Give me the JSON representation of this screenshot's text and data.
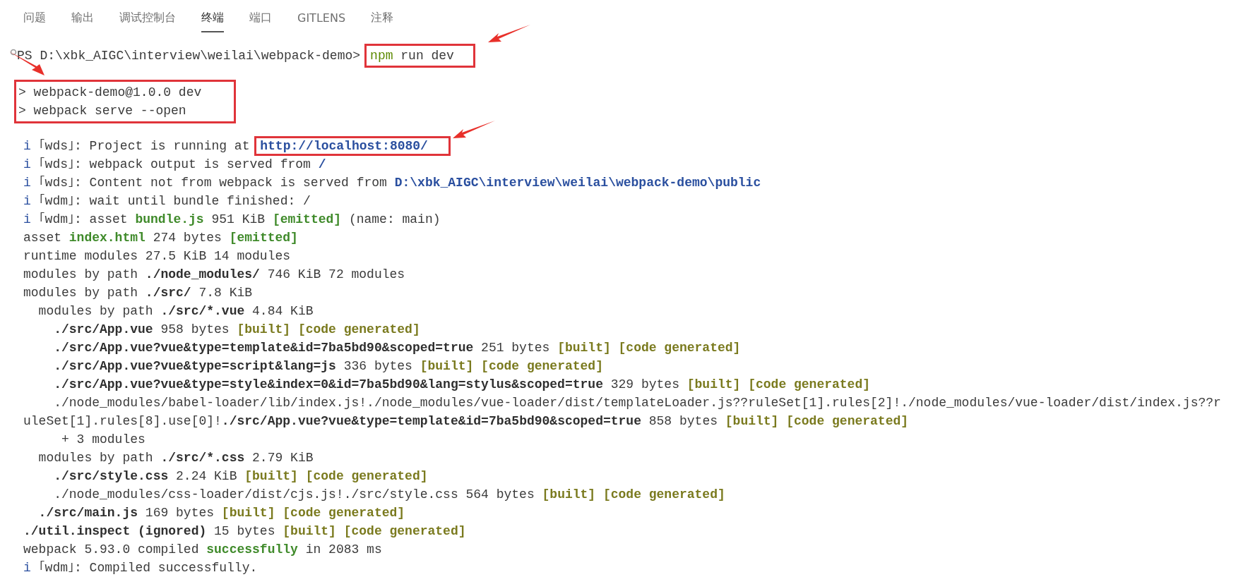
{
  "tabs": [
    {
      "label": "问题",
      "selected": false
    },
    {
      "label": "输出",
      "selected": false
    },
    {
      "label": "调试控制台",
      "selected": false
    },
    {
      "label": "终端",
      "selected": true
    },
    {
      "label": "端口",
      "selected": false
    },
    {
      "label": "GITLENS",
      "selected": false
    },
    {
      "label": "注释",
      "selected": false
    }
  ],
  "prompt": {
    "path": "PS D:\\xbk_AIGC\\interview\\weilai\\webpack-demo>",
    "command": [
      {
        "text": "npm",
        "kind": "command"
      },
      {
        "text": " run dev",
        "kind": "plain"
      }
    ],
    "boxed": true
  },
  "script_echo": {
    "boxed": true,
    "lines": [
      "> webpack-demo@1.0.0 dev",
      "> webpack serve --open"
    ]
  },
  "log_lines": [
    {
      "segments": [
        {
          "text": "i",
          "kind": "info"
        },
        {
          "text": " ｢wds｣: Project is running at ",
          "kind": "plain"
        },
        {
          "text": "http://localhost:8080/",
          "kind": "link",
          "boxed": true
        }
      ]
    },
    {
      "segments": [
        {
          "text": "i",
          "kind": "info"
        },
        {
          "text": " ｢wds｣: webpack output is served from ",
          "kind": "plain"
        },
        {
          "text": "/",
          "kind": "path"
        }
      ]
    },
    {
      "segments": [
        {
          "text": "i",
          "kind": "info"
        },
        {
          "text": " ｢wds｣: Content not from webpack is served from ",
          "kind": "plain"
        },
        {
          "text": "D:\\xbk_AIGC\\interview\\weilai\\webpack-demo\\public",
          "kind": "path"
        }
      ]
    },
    {
      "segments": [
        {
          "text": "i",
          "kind": "info"
        },
        {
          "text": " ｢wdm｣: wait until bundle finished: /",
          "kind": "plain"
        }
      ]
    },
    {
      "segments": [
        {
          "text": "i",
          "kind": "info"
        },
        {
          "text": " ｢wdm｣: asset ",
          "kind": "plain"
        },
        {
          "text": "bundle.js",
          "kind": "success"
        },
        {
          "text": " 951 KiB ",
          "kind": "plain"
        },
        {
          "text": "[emitted]",
          "kind": "success"
        },
        {
          "text": " (name: main)",
          "kind": "plain"
        }
      ]
    },
    {
      "segments": [
        {
          "text": "asset ",
          "kind": "plain"
        },
        {
          "text": "index.html",
          "kind": "success"
        },
        {
          "text": " 274 bytes ",
          "kind": "plain"
        },
        {
          "text": "[emitted]",
          "kind": "success"
        }
      ]
    },
    {
      "segments": [
        {
          "text": "runtime modules 27.5 KiB 14 modules",
          "kind": "plain"
        }
      ]
    },
    {
      "segments": [
        {
          "text": "modules by path ",
          "kind": "plain"
        },
        {
          "text": "./node_modules/",
          "kind": "bold"
        },
        {
          "text": " 746 KiB 72 modules",
          "kind": "plain"
        }
      ]
    },
    {
      "segments": [
        {
          "text": "modules by path ",
          "kind": "plain"
        },
        {
          "text": "./src/",
          "kind": "bold"
        },
        {
          "text": " 7.8 KiB",
          "kind": "plain"
        }
      ]
    },
    {
      "segments": [
        {
          "text": "  modules by path ",
          "kind": "plain"
        },
        {
          "text": "./src/*.vue",
          "kind": "bold"
        },
        {
          "text": " 4.84 KiB",
          "kind": "plain"
        }
      ]
    },
    {
      "segments": [
        {
          "text": "    ./src/App.vue",
          "kind": "bold"
        },
        {
          "text": " 958 bytes ",
          "kind": "plain"
        },
        {
          "text": "[built] [code generated]",
          "kind": "note"
        }
      ]
    },
    {
      "segments": [
        {
          "text": "    ./src/App.vue?vue&type=template&id=7ba5bd90&scoped=true",
          "kind": "bold"
        },
        {
          "text": " 251 bytes ",
          "kind": "plain"
        },
        {
          "text": "[built] [code generated]",
          "kind": "note"
        }
      ]
    },
    {
      "segments": [
        {
          "text": "    ./src/App.vue?vue&type=script&lang=js",
          "kind": "bold"
        },
        {
          "text": " 336 bytes ",
          "kind": "plain"
        },
        {
          "text": "[built] [code generated]",
          "kind": "note"
        }
      ]
    },
    {
      "segments": [
        {
          "text": "    ./src/App.vue?vue&type=style&index=0&id=7ba5bd90&lang=stylus&scoped=true",
          "kind": "bold"
        },
        {
          "text": " 329 bytes ",
          "kind": "plain"
        },
        {
          "text": "[built] [code generated]",
          "kind": "note"
        }
      ]
    },
    {
      "segments": [
        {
          "text": "    ./node_modules/babel-loader/lib/index.js!./node_modules/vue-loader/dist/templateLoader.js??ruleSet[1].rules[2]!./node_modules/vue-loader/dist/index.js??r",
          "kind": "plain"
        }
      ]
    },
    {
      "segments": [
        {
          "text": "uleSet[1].rules[8].use[0]!",
          "kind": "plain"
        },
        {
          "text": "./src/App.vue?vue&type=template&id=7ba5bd90&scoped=true",
          "kind": "bold"
        },
        {
          "text": " 858 bytes ",
          "kind": "plain"
        },
        {
          "text": "[built] [code generated]",
          "kind": "note"
        }
      ]
    },
    {
      "segments": [
        {
          "text": "     + 3 modules",
          "kind": "plain"
        }
      ]
    },
    {
      "segments": [
        {
          "text": "  modules by path ",
          "kind": "plain"
        },
        {
          "text": "./src/*.css",
          "kind": "bold"
        },
        {
          "text": " 2.79 KiB",
          "kind": "plain"
        }
      ]
    },
    {
      "segments": [
        {
          "text": "    ./src/style.css",
          "kind": "bold"
        },
        {
          "text": " 2.24 KiB ",
          "kind": "plain"
        },
        {
          "text": "[built] [code generated]",
          "kind": "note"
        }
      ]
    },
    {
      "segments": [
        {
          "text": "    ./node_modules/css-loader/dist/cjs.js!./src/style.css 564 bytes ",
          "kind": "plain"
        },
        {
          "text": "[built] [code generated]",
          "kind": "note"
        }
      ]
    },
    {
      "segments": [
        {
          "text": "  ./src/main.js",
          "kind": "bold"
        },
        {
          "text": " 169 bytes ",
          "kind": "plain"
        },
        {
          "text": "[built] [code generated]",
          "kind": "note"
        }
      ]
    },
    {
      "segments": [
        {
          "text": "./util.inspect (ignored)",
          "kind": "bold"
        },
        {
          "text": " 15 bytes ",
          "kind": "plain"
        },
        {
          "text": "[built] [code generated]",
          "kind": "note"
        }
      ]
    },
    {
      "segments": [
        {
          "text": "webpack 5.93.0 compiled ",
          "kind": "plain"
        },
        {
          "text": "successfully",
          "kind": "success"
        },
        {
          "text": " in 2083 ms",
          "kind": "plain"
        }
      ]
    },
    {
      "segments": [
        {
          "text": "i",
          "kind": "info"
        },
        {
          "text": " ｢wdm｣: Compiled successfully.",
          "kind": "plain"
        }
      ]
    }
  ]
}
